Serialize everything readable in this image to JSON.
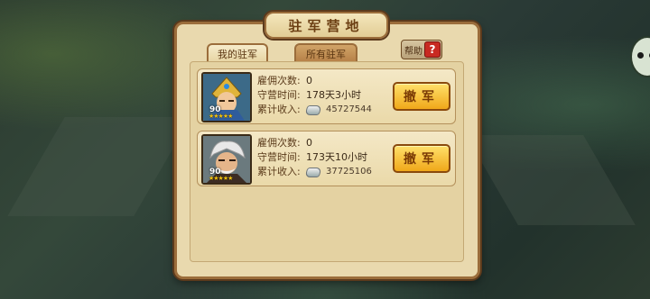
{
  "header": {
    "title": "驻军营地"
  },
  "tabs": [
    {
      "label": "我的驻军",
      "active": true
    },
    {
      "label": "所有驻军",
      "active": false
    }
  ],
  "help": {
    "label": "帮助",
    "icon_char": "?"
  },
  "labels": {
    "hire_count": "雇佣次数:",
    "garrison_time": "守营时间:",
    "total_income": "累计收入:",
    "withdraw": "撤军"
  },
  "garrisons": [
    {
      "level": "90",
      "stars": "★★★★★",
      "hire_count": "0",
      "garrison_time": "178天3小时",
      "total_income": "45727544",
      "portrait_icon": "golden-helmet-general-portrait"
    },
    {
      "level": "90",
      "stars": "★★★★★",
      "hire_count": "0",
      "garrison_time": "173天10小时",
      "total_income": "37725106",
      "portrait_icon": "white-haired-general-portrait"
    }
  ],
  "colors": {
    "panel_bg": "#e9d9ae",
    "panel_border": "#9b6d3b",
    "button_gold": "#f0a81a",
    "help_red": "#c82a22"
  }
}
